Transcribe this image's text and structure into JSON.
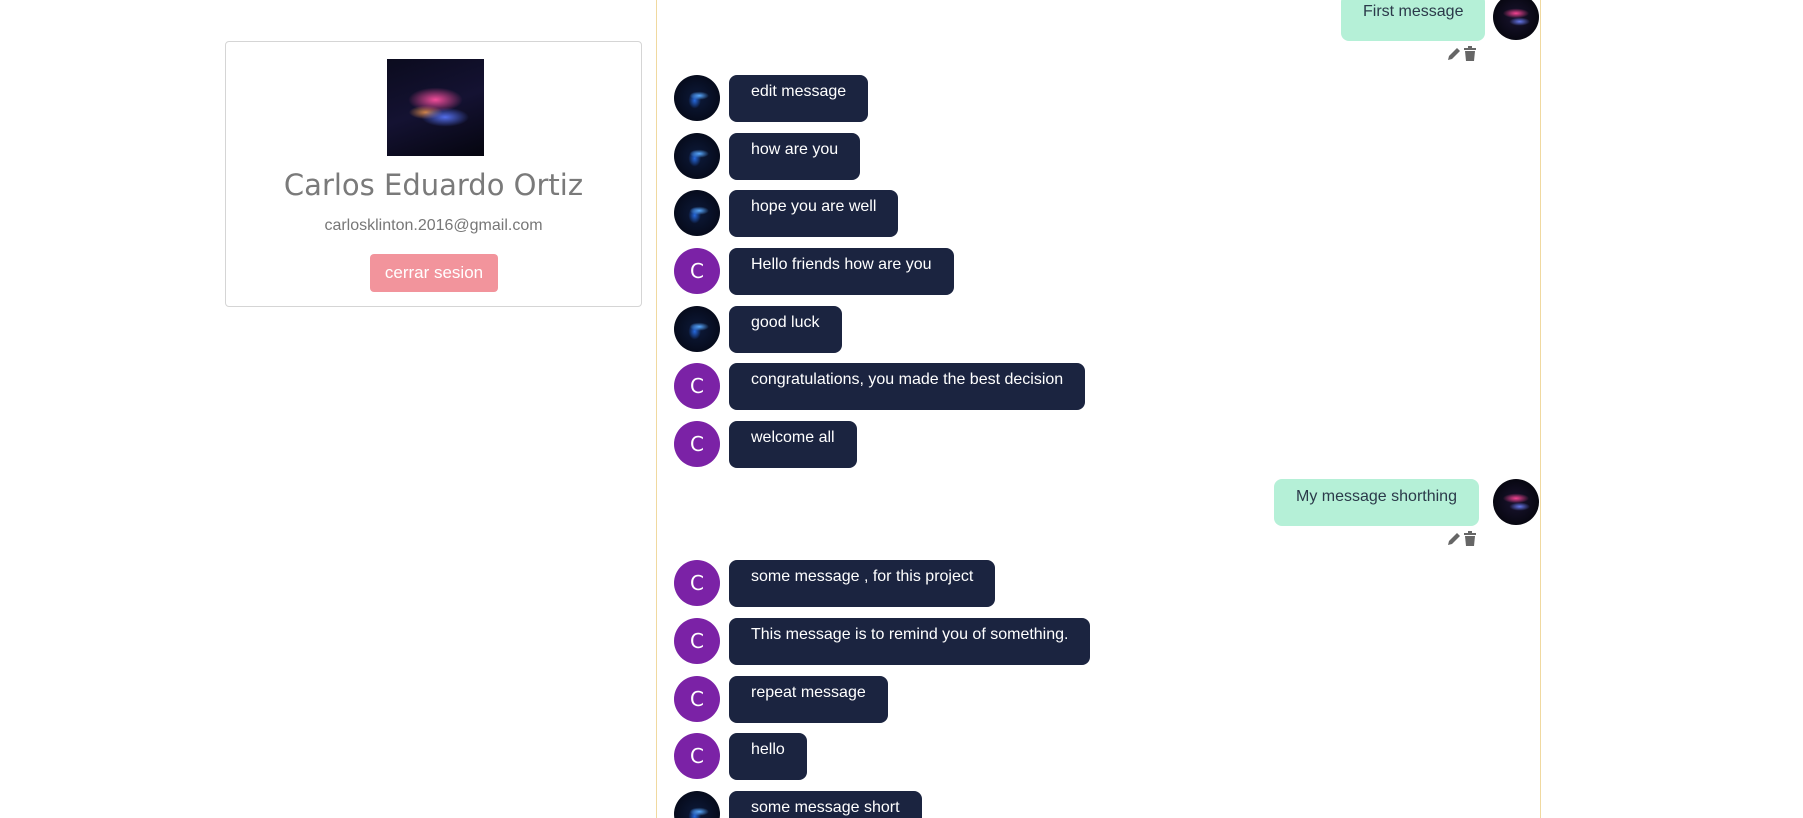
{
  "profile": {
    "name": "Carlos Eduardo Ortiz",
    "email": "carlosklinton.2016@gmail.com",
    "logout_label": "cerrar sesion"
  },
  "chat": {
    "messages": [
      {
        "direction": "out",
        "text": "First message",
        "avatar": "image"
      },
      {
        "direction": "in",
        "text": "edit message",
        "avatar": "image"
      },
      {
        "direction": "in",
        "text": "how are you",
        "avatar": "image"
      },
      {
        "direction": "in",
        "text": "hope you are well",
        "avatar": "image"
      },
      {
        "direction": "in",
        "text": "Hello friends how are you",
        "avatar": "C"
      },
      {
        "direction": "in",
        "text": "good luck",
        "avatar": "image"
      },
      {
        "direction": "in",
        "text": "congratulations, you made the best decision",
        "avatar": "C"
      },
      {
        "direction": "in",
        "text": "welcome all",
        "avatar": "C"
      },
      {
        "direction": "out",
        "text": "My message shorthing",
        "avatar": "image"
      },
      {
        "direction": "in",
        "text": "some message , for this project",
        "avatar": "C"
      },
      {
        "direction": "in",
        "text": "This message is to remind you of something.",
        "avatar": "C"
      },
      {
        "direction": "in",
        "text": "repeat message",
        "avatar": "C"
      },
      {
        "direction": "in",
        "text": "hello",
        "avatar": "C"
      },
      {
        "direction": "in",
        "text": "some message short",
        "avatar": "image"
      }
    ]
  },
  "icons": {
    "edit": "pencil-icon",
    "delete": "trash-icon"
  },
  "colors": {
    "incoming_bubble": "#1b2440",
    "outgoing_bubble": "#b5f0d7",
    "letter_avatar": "#7b22a6",
    "logout_button": "#f2949c",
    "chat_border": "#f0d9a0"
  }
}
